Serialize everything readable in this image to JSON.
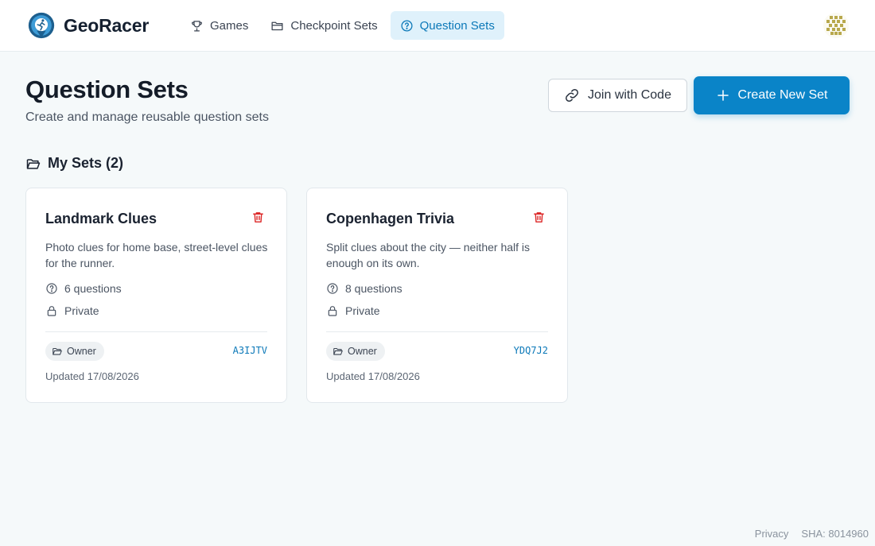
{
  "app": {
    "name": "GeoRacer",
    "logo_icon": "runner-pin-logo",
    "accent_color": "#0a84c8",
    "danger_color": "#dc2626"
  },
  "nav": {
    "items": [
      {
        "label": "Games",
        "icon": "trophy-icon",
        "active": false
      },
      {
        "label": "Checkpoint Sets",
        "icon": "folder-icon",
        "active": false
      },
      {
        "label": "Question Sets",
        "icon": "question-circle-icon",
        "active": true
      }
    ]
  },
  "user": {
    "avatar_icon": "identicon-avatar"
  },
  "page": {
    "title": "Question Sets",
    "subtitle": "Create and manage reusable question sets",
    "join_button": "Join with Code",
    "create_button": "Create New Set"
  },
  "section": {
    "title": "My Sets (2)",
    "icon": "folder-open-icon"
  },
  "sets": [
    {
      "title": "Landmark Clues",
      "description": "Photo clues for home base, street-level clues for the runner.",
      "questions": "6 questions",
      "visibility": "Private",
      "role": "Owner",
      "code": "A3IJTV",
      "updated": "Updated 17/08/2026"
    },
    {
      "title": "Copenhagen Trivia",
      "description": "Split clues about the city — neither half is enough on its own.",
      "questions": "8 questions",
      "visibility": "Private",
      "role": "Owner",
      "code": "YDQ7J2",
      "updated": "Updated 17/08/2026"
    }
  ],
  "footer": {
    "privacy": "Privacy",
    "sha": "SHA: 8014960"
  }
}
